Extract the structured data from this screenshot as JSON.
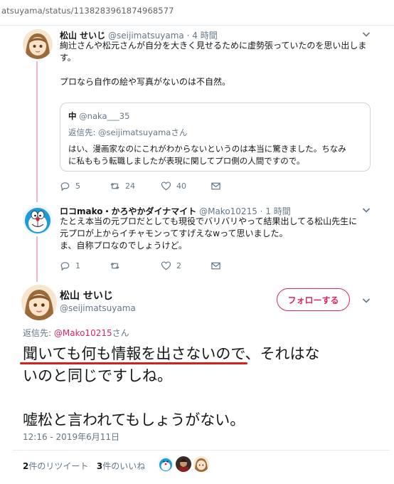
{
  "browser": {
    "url": "atsuyama/status/1138283961874968577"
  },
  "colors": {
    "accent": "#e0245e",
    "thread_line": "#f4b4c9",
    "underline": "#d62020"
  },
  "tweet1": {
    "name": "松山 せいじ",
    "handle": "@seijimatsuyama",
    "dot": "·",
    "time": "4 時間",
    "lines": [
      "絢辻さんや松元さんが自分を大きく見せるために虚勢張っていたのを思い出しま",
      "す。",
      "",
      "プロなら自作の絵や写真がないのは不自然。"
    ],
    "quote": {
      "name": "中",
      "handle": "@naka___35",
      "reply_label": "返信先: ",
      "reply_handle": "@seijimatsuyama",
      "reply_suffix": "さん",
      "lines": [
        "はい、漫画家なのにこれがわからないというのは本当に驚きました。ちなみ",
        "に私ももう転職しましたが表現に関してプロ側の人間ですので。"
      ]
    },
    "actions": {
      "replies": "5",
      "retweets": "24",
      "likes": "40"
    }
  },
  "tweet2": {
    "name": "ロコmako・かろやかダイナマイト",
    "handle": "@Mako10215",
    "dot": "·",
    "time": "1 時間",
    "lines": [
      "たとえ本当の元プロだとしても現役でバリバリやって結果出してる松山先生に",
      "元プロが上からイチャモンってすげえなwって思いました。",
      "ま、自称プロなのでしょうけど。"
    ],
    "actions": {
      "replies": "1",
      "retweets": "",
      "likes": "2"
    }
  },
  "main": {
    "name": "松山 せいじ",
    "handle": "@seijimatsuyama",
    "follow_label": "フォローする",
    "reply_label": "返信先: ",
    "reply_handle": "@Mako10215",
    "reply_suffix": "さん",
    "lines": [
      "聞いても何も情報を出さないので、それはな",
      "いのと同じですしね。",
      "",
      "嘘松と言われてもしょうがない。"
    ],
    "timestamp": "12:16 - 2019年6月11日",
    "retweet_count": "2",
    "retweet_label": "件のリツイート",
    "like_count": "3",
    "like_label": "件のいいね"
  },
  "icons": [
    "chevron-down-icon",
    "reply-icon",
    "retweet-icon",
    "heart-icon",
    "mail-icon"
  ]
}
